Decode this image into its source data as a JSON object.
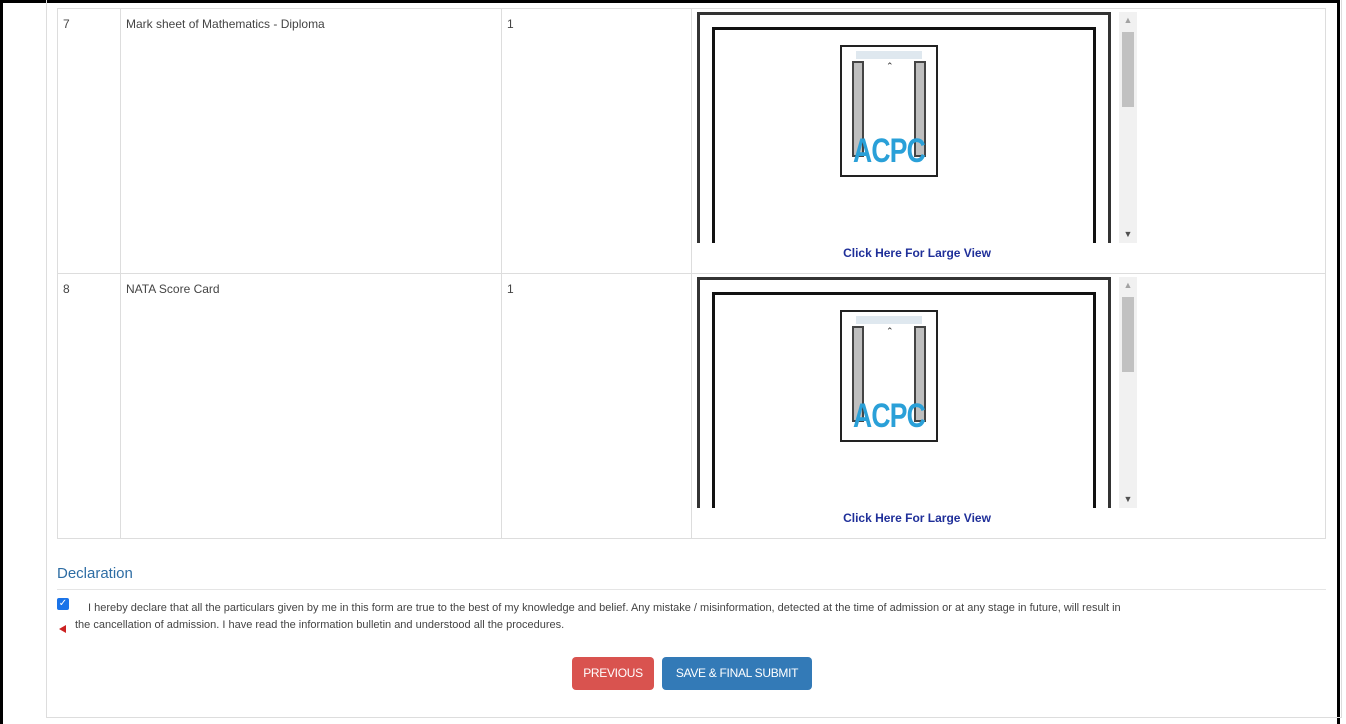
{
  "documents": [
    {
      "sr_no": "7",
      "name": "Mark sheet of Mathematics - Diploma",
      "count": "1",
      "preview_logo_text": "ACPC",
      "large_view_link": "Click Here For Large View"
    },
    {
      "sr_no": "8",
      "name": "NATA Score Card",
      "count": "1",
      "preview_logo_text": "ACPC",
      "large_view_link": "Click Here For Large View"
    }
  ],
  "declaration": {
    "title": "Declaration",
    "checked": true,
    "text_line1": "I hereby declare that all the particulars given by me in this form are true to the best of my knowledge and belief. Any mistake / misinformation, detected at the time of admission or at any stage in future, will result in",
    "text_line2": "the cancellation of admission. I have read the information bulletin and understood all the procedures."
  },
  "buttons": {
    "previous": "PREVIOUS",
    "submit": "SAVE & FINAL SUBMIT"
  },
  "colors": {
    "heading": "#2e6da4",
    "link": "#1f2f99",
    "previous_button": "#d9534f",
    "submit_button": "#337ab7",
    "logo_text": "#2aa0d8"
  },
  "icons": {
    "checkbox": "checkbox-checked-icon",
    "scroll_up": "arrow-up-icon",
    "scroll_down": "arrow-down-icon",
    "marker": "red-triangle-icon"
  }
}
